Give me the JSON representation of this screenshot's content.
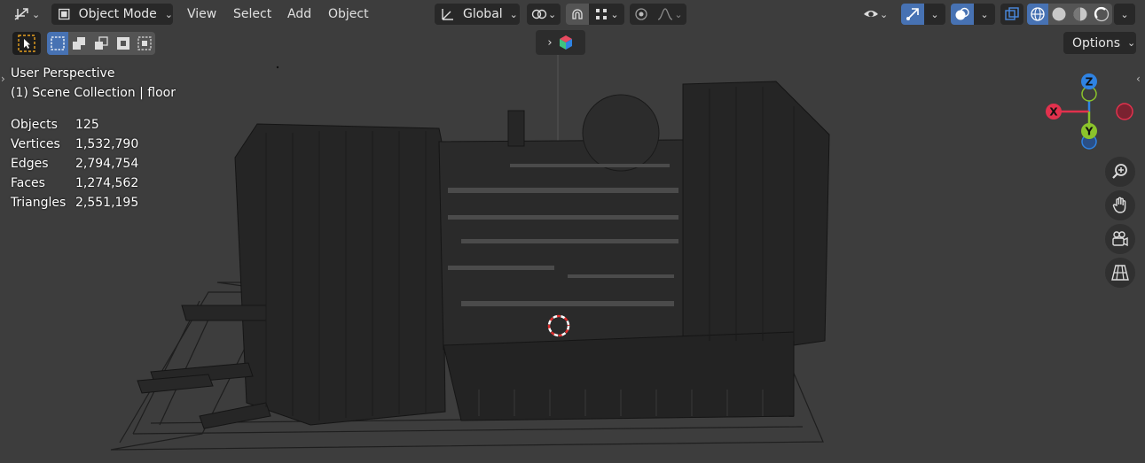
{
  "header": {
    "editor_type_icon": "axis-transform-icon",
    "mode_label": "Object Mode",
    "mode_icon": "object-mode-icon",
    "menus": [
      "View",
      "Select",
      "Add",
      "Object"
    ],
    "orientation_label": "Global",
    "orientation_icon": "transform-orientation-icon",
    "pivot_icon": "link-pivot-icon",
    "snap_icon": "magnet-icon",
    "snap_target_icon": "snap-grid-icon",
    "proportional_icon": "proportional-edit-icon",
    "falloff_icon": "falloff-curve-icon",
    "visibility_icon": "eye-visibility-icon",
    "gizmo_icon": "gizmo-icon",
    "overlay_icon": "overlays-icon",
    "xray_icon": "xray-icon",
    "shading_icons": [
      "wireframe-shading-icon",
      "solid-shading-icon",
      "material-shading-icon",
      "rendered-shading-icon"
    ],
    "accent_color": "#4772b3"
  },
  "toolbar": {
    "select_tool_icon": "cursor-select-icon",
    "select_modes": [
      "select-new-icon",
      "select-extend-icon",
      "select-subtract-icon",
      "select-invert-icon",
      "select-intersect-icon"
    ]
  },
  "options": {
    "label": "Options"
  },
  "overlay": {
    "view_name": "User Perspective",
    "collection": "(1) Scene Collection | floor",
    "stats": [
      {
        "label": "Objects",
        "value": "125"
      },
      {
        "label": "Vertices",
        "value": "1,532,790"
      },
      {
        "label": "Edges",
        "value": "2,794,754"
      },
      {
        "label": "Faces",
        "value": "1,274,562"
      },
      {
        "label": "Triangles",
        "value": "2,551,195"
      }
    ]
  },
  "gizmo": {
    "labels": {
      "x": "X",
      "y": "Y",
      "z": "Z"
    },
    "colors": {
      "x": "#e2314d",
      "y": "#8bc42b",
      "z": "#2f83e3"
    }
  },
  "nav_buttons": [
    "zoom-icon",
    "hand-pan-icon",
    "camera-view-icon",
    "perspective-grid-icon"
  ]
}
